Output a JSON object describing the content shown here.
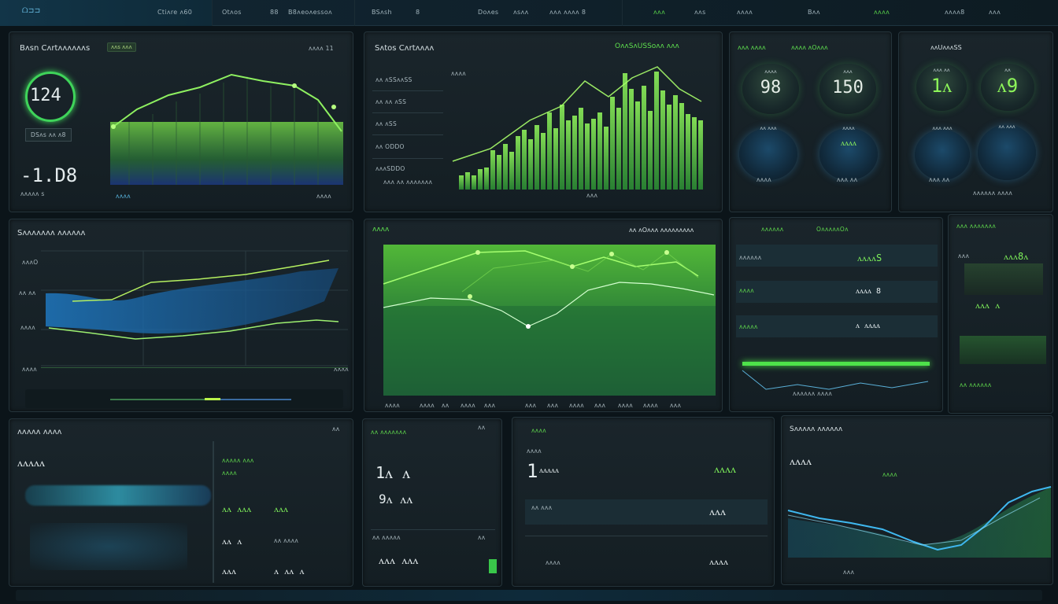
{
  "topbar": {
    "brand": "ᗝ⊐⊐",
    "items": [
      "Ctiᴧre ᴧ60",
      "Otᴧos",
      "88",
      "B8ᴧeoᴧessoᴧ",
      "BSᴧsh",
      "8",
      "Doᴧes",
      "ᴧsᴧᴧ",
      "ᴧᴧᴧ ᴧᴧᴧᴧ 8",
      "ᴧᴧᴧ",
      "ᴧᴧs",
      "ᴧᴧᴧᴧ",
      "Bᴧᴧ",
      "ᴧᴧᴧᴧ",
      "ᴧᴧᴧᴧ8",
      "ᴧᴧᴧ"
    ]
  },
  "panels": {
    "p1": {
      "title": "Bᴧsn Cᴧrtᴧᴧᴧᴧᴧᴧs",
      "chip": "ᴧᴧs ᴧᴧᴧ",
      "corner": "ᴧᴧᴧᴧ 11",
      "ring_value": "124",
      "legend": "DSᴧs ᴧᴧ ᴧ8",
      "big_value": "-1.D8",
      "sub_label": "ᴧᴧᴧᴧᴧ s",
      "axis_left": "ᴧᴧᴧᴧ",
      "axis_right": "ᴧᴧᴧᴧ"
    },
    "p2": {
      "title": "Sᴧtos Cᴧrtᴧᴧᴧᴧ",
      "title_right": "OᴧᴧSᴧUSSoᴧᴧ ᴧᴧᴧ",
      "stats": [
        "ᴧᴧ ᴧSSᴧᴧSS",
        "ᴧᴧ ᴧᴧ ᴧSS",
        "ᴧᴧ ᴧSS",
        "ᴧᴧ ODDO",
        "ᴧᴧᴧSDDO",
        "ᴧᴧᴧ ᴧᴧ ᴧᴧᴧᴧᴧᴧᴧ"
      ],
      "legend": "ᴧᴧᴧᴧ",
      "axis": "ᴧᴧᴧ"
    },
    "p3": {
      "title": "ᴧᴧᴧ ᴧᴧᴧᴧ",
      "title_right": "ᴧᴧᴧᴧ ᴧOᴧᴧᴧ",
      "gauges": [
        {
          "value": "98",
          "label": "ᴧᴧᴧᴧ"
        },
        {
          "value": "150",
          "label": "ᴧᴧᴧ"
        },
        {
          "value": "",
          "label": "ᴧᴧ ᴧᴧᴧ"
        },
        {
          "value": "ᴧᴧᴧᴧ",
          "label": "ᴧᴧᴧᴧ"
        }
      ],
      "footer_left": "ᴧᴧᴧᴧ",
      "footer_right": "ᴧᴧᴧ ᴧᴧ"
    },
    "p4": {
      "title": "ᴧᴧUᴧᴧᴧSS",
      "gauges": [
        {
          "value": "1ᴧ",
          "label": "ᴧᴧᴧ ᴧᴧ"
        },
        {
          "value": "ᴧ9",
          "label": "ᴧᴧ"
        },
        {
          "value": "",
          "label": "ᴧᴧᴧ ᴧᴧᴧ"
        },
        {
          "value": "",
          "label": "ᴧᴧ ᴧᴧᴧ"
        }
      ],
      "footer_left": "ᴧᴧᴧ ᴧᴧ",
      "footer_right": "ᴧᴧᴧᴧᴧᴧ ᴧᴧᴧᴧ"
    },
    "p5": {
      "title": "Sᴧᴧᴧᴧᴧᴧᴧ ᴧᴧᴧᴧᴧᴧ",
      "y_top": "ᴧᴧᴧO",
      "y_mid": "ᴧᴧ ᴧᴧ",
      "y_low": "ᴧᴧᴧᴧ",
      "y_bottom": "ᴧᴧᴧᴧ",
      "axis_right": "ᴧᴧᴧᴧ"
    },
    "p6": {
      "title": "ᴧᴧᴧᴧ",
      "title_right": "ᴧᴧ ᴧOᴧᴧᴧ ᴧᴧᴧᴧᴧᴧᴧᴧᴧ",
      "x_labels": [
        "ᴧᴧᴧᴧ",
        "ᴧᴧᴧᴧ",
        "ᴧᴧ",
        "ᴧᴧᴧᴧ",
        "ᴧᴧᴧ",
        "ᴧᴧᴧ",
        "ᴧᴧᴧ",
        "ᴧᴧᴧᴧ",
        "ᴧᴧᴧ",
        "ᴧᴧᴧᴧ",
        "ᴧᴧᴧᴧ",
        "ᴧᴧᴧ"
      ]
    },
    "p7": {
      "title_left": "ᴧᴧᴧᴧᴧᴧ",
      "title_right": "OᴧᴧᴧᴧᴧOᴧ",
      "rows": [
        {
          "label": "ᴧᴧᴧᴧᴧᴧ",
          "value": "ᴧᴧᴧᴧS"
        },
        {
          "label": "ᴧᴧᴧᴧ",
          "value": "ᴧᴧᴧᴧ 8"
        },
        {
          "label": "ᴧᴧᴧᴧᴧ",
          "value": "ᴧ ᴧᴧᴧᴧ"
        }
      ],
      "footer": "ᴧᴧᴧᴧᴧᴧ ᴧᴧᴧᴧ"
    },
    "p8": {
      "title": "ᴧᴧᴧ ᴧᴧᴧᴧᴧᴧᴧ",
      "v1": "ᴧᴧᴧ",
      "v2": "ᴧᴧᴧ8ᴧ",
      "v3": "ᴧᴧᴧ ᴧ",
      "footer": "ᴧᴧ ᴧᴧᴧᴧᴧᴧ"
    },
    "p9": {
      "title": "ᴧᴧᴧᴧᴧ ᴧᴧᴧᴧ",
      "corner": "ᴧᴧ",
      "big_value": "ᴧᴧᴧᴧᴧ",
      "labels": [
        "ᴧᴧᴧᴧᴧ ᴧᴧᴧ",
        "ᴧᴧᴧᴧ",
        "ᴧᴧ ᴧᴧᴧ",
        "ᴧᴧᴧ",
        "ᴧᴧ ᴧ",
        "ᴧᴧ ᴧᴧᴧᴧ",
        "ᴧᴧᴧ",
        "ᴧ ᴧᴧ ᴧ"
      ]
    },
    "p10": {
      "title": "ᴧᴧ ᴧᴧᴧᴧᴧᴧᴧ",
      "corner": "ᴧᴧ",
      "v1": "1ᴧ ᴧ",
      "v2": "9ᴧ ᴧᴧ",
      "footer": "ᴧᴧ ᴧᴧᴧᴧᴧ",
      "footer_right": "ᴧᴧ",
      "v3": "ᴧᴧᴧ ᴧᴧᴧ"
    },
    "p11": {
      "title": "ᴧᴧᴧᴧ",
      "sub": "ᴧᴧᴧᴧ",
      "big": "1",
      "big2": "ᴧᴧᴧᴧᴧ",
      "v1": "ᴧᴧᴧᴧ",
      "label": "ᴧᴧ ᴧᴧᴧ",
      "v2": "ᴧᴧᴧ",
      "v3": "ᴧᴧᴧᴧ",
      "footer": "ᴧᴧᴧᴧ"
    },
    "p12": {
      "title": "Sᴧᴧᴧᴧᴧ ᴧᴧᴧᴧᴧᴧ",
      "big": "ᴧᴧᴧᴧ",
      "chip": "ᴧᴧᴧᴧ",
      "axis": "ᴧᴧᴧ"
    }
  }
}
